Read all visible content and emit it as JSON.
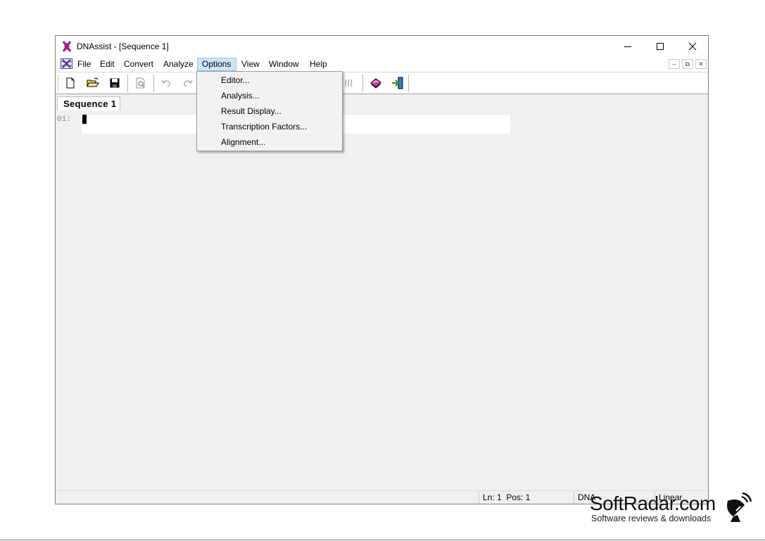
{
  "window": {
    "title": "DNAssist - [Sequence 1]",
    "controls": {
      "minimize_icon": "minimize-icon",
      "maximize_icon": "maximize-icon",
      "close_icon": "close-icon"
    }
  },
  "menubar": {
    "items": [
      {
        "label": "File"
      },
      {
        "label": "Edit"
      },
      {
        "label": "Convert"
      },
      {
        "label": "Analyze"
      },
      {
        "label": "Options",
        "active": true
      },
      {
        "label": "View"
      },
      {
        "label": "Window"
      },
      {
        "label": "Help"
      }
    ]
  },
  "options_menu": {
    "items": [
      {
        "label": "Editor..."
      },
      {
        "label": "Analysis..."
      },
      {
        "label": "Result Display..."
      },
      {
        "label": "Transcription Factors..."
      },
      {
        "label": "Alignment..."
      }
    ]
  },
  "toolbar": {
    "icons": [
      "new-file-icon",
      "open-folder-icon",
      "save-icon",
      "print-preview-icon",
      "undo-icon",
      "redo-icon",
      "hidden-tool-icon",
      "book-icon",
      "exit-icon"
    ]
  },
  "document": {
    "tab_label": "Sequence 1",
    "line_number": "01:"
  },
  "statusbar": {
    "position": "Ln: 1  Pos: 1",
    "molecule": "DNA",
    "topology": "Linear"
  },
  "watermark": {
    "brand": "SoftRadar.com",
    "tagline": "Software reviews & downloads"
  },
  "colors": {
    "menu_highlight": "#cce4f7",
    "menu_highlight_border": "#99c9ef",
    "workspace": "#f0f0f0"
  }
}
